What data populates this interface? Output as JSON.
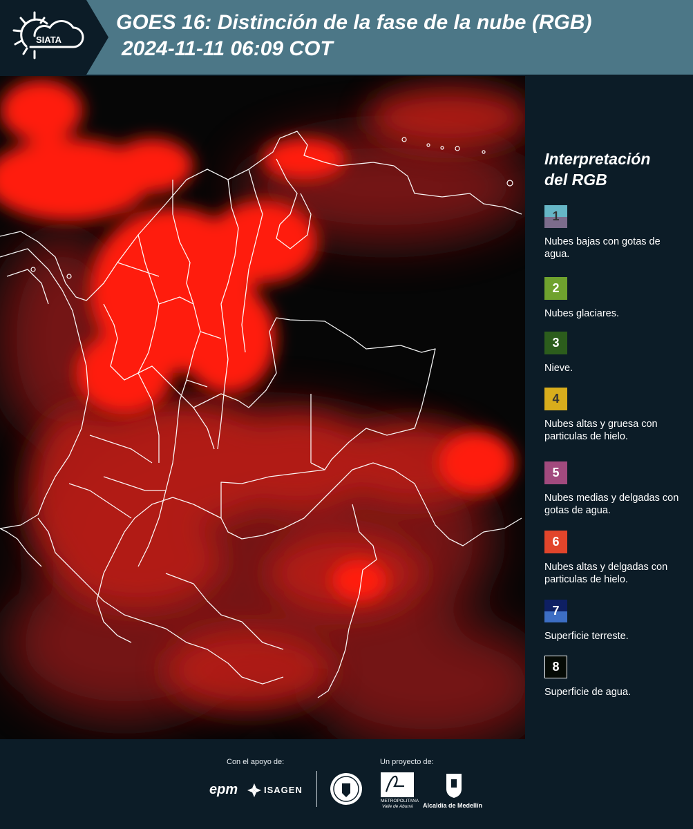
{
  "header": {
    "logo_text": "SIATA",
    "title_line1": "GOES 16: Distinción de la fase de la nube (RGB)",
    "title_line2": "2024-11-11 06:09 COT"
  },
  "legend": {
    "title_line1": "Interpretación",
    "title_line2": "del RGB",
    "items": [
      {
        "number": "1",
        "label": "Nubes bajas con gotas de agua.",
        "color_top": "#66b6c6",
        "color_bottom": "#7c6c8c",
        "num_color": "#333333"
      },
      {
        "number": "2",
        "label": "Nubes glaciares.",
        "color_top": "#6fa22e",
        "color_bottom": "#6fa22e",
        "num_color": "#ffffff"
      },
      {
        "number": "3",
        "label": "Nieve.",
        "color_top": "#2c5d1c",
        "color_bottom": "#2c5d1c",
        "num_color": "#ffffff"
      },
      {
        "number": "4",
        "label": "Nubes altas y gruesa con particulas de hielo.",
        "color_top": "#d8ad1c",
        "color_bottom": "#d8ad1c",
        "num_color": "#333333"
      },
      {
        "number": "5",
        "label": "Nubes medias y delgadas con gotas de agua.",
        "color_top": "#a24a7e",
        "color_bottom": "#a24a7e",
        "num_color": "#ffffff"
      },
      {
        "number": "6",
        "label": "Nubes altas y delgadas con particulas de hielo.",
        "color_top": "#e2452b",
        "color_bottom": "#e2452b",
        "num_color": "#ffffff"
      },
      {
        "number": "7",
        "label": "Superficie terreste.",
        "color_top": "#0e1f63",
        "color_bottom": "#3d6ec4",
        "num_color": "#ffffff"
      },
      {
        "number": "8",
        "label": "Superficie de agua.",
        "color_top": "#050a05",
        "color_bottom": "#050a05",
        "num_color": "#ffffff"
      }
    ]
  },
  "footer": {
    "support_caption": "Con el apoyo de:",
    "project_caption": "Un proyecto de:",
    "epm": "epm",
    "isagen": "ISAGEN",
    "area_metro_line1": "METROPOLITANA",
    "area_metro_line2": "Valle de Aburrá",
    "alcaldia": "Alcaldía de Medellín"
  },
  "colors": {
    "header_bg": "#4c7787",
    "panel_bg": "#0c1c27",
    "cloud_red": "#ff1a10"
  }
}
